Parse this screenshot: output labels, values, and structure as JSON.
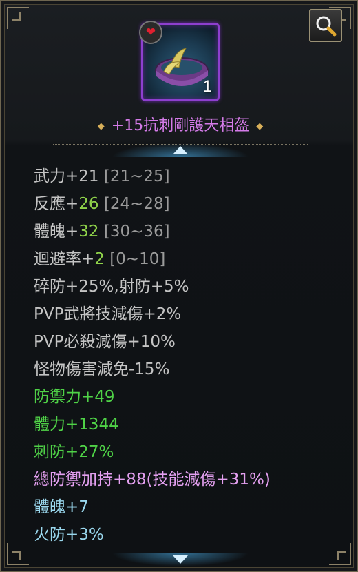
{
  "item": {
    "name": "+15抗刺剛護天相盔",
    "count": "1",
    "icon": "purple-ring-icon",
    "badge_icon": "heart-icon"
  },
  "controls": {
    "zoom_icon": "magnifier-icon",
    "scroll_up_icon": "arrow-up-icon",
    "scroll_down_icon": "arrow-down-icon"
  },
  "colors": {
    "title": "#d47be8",
    "base_stat": "#c4c4c4",
    "bonus_value": "#8fd24a",
    "extra_stat": "#4fd247",
    "set_bonus": "#e4a0f0",
    "socket_stat": "#9ad8ee"
  },
  "stats": {
    "s1": {
      "label": "武力+21",
      "range": "[21~25]"
    },
    "s2": {
      "label": "反應+",
      "value": "26",
      "range": "[24~28]"
    },
    "s3": {
      "label": "體魄+",
      "value": "32",
      "range": "[30~36]"
    },
    "s4": {
      "label": "迴避率+",
      "value": "2",
      "range": "[0~10]"
    },
    "s5": "碎防+25%,射防+5%",
    "s6": "PVP武將技減傷+2%",
    "s7": "PVP必殺減傷+10%",
    "s8": "怪物傷害減免-15%",
    "s9": "防禦力+49",
    "s10": "體力+1344",
    "s11": "刺防+27%",
    "s12": "總防禦加持+88(技能減傷+31%)",
    "s13": "體魄+7",
    "s14": "火防+3%"
  }
}
